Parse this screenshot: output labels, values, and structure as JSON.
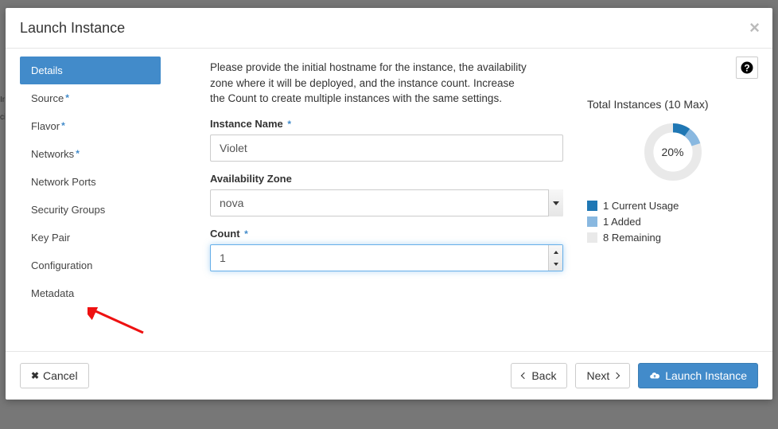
{
  "modal": {
    "title": "Launch Instance"
  },
  "sidebar": {
    "items": [
      {
        "label": "Details",
        "active": true,
        "required": false
      },
      {
        "label": "Source",
        "active": false,
        "required": true
      },
      {
        "label": "Flavor",
        "active": false,
        "required": true
      },
      {
        "label": "Networks",
        "active": false,
        "required": true
      },
      {
        "label": "Network Ports",
        "active": false,
        "required": false
      },
      {
        "label": "Security Groups",
        "active": false,
        "required": false
      },
      {
        "label": "Key Pair",
        "active": false,
        "required": false
      },
      {
        "label": "Configuration",
        "active": false,
        "required": false
      },
      {
        "label": "Metadata",
        "active": false,
        "required": false
      }
    ]
  },
  "intro": "Please provide the initial hostname for the instance, the availability zone where it will be deployed, and the instance count. Increase the Count to create multiple instances with the same settings.",
  "form": {
    "instance_name": {
      "label": "Instance Name",
      "value": "Violet"
    },
    "availability_zone": {
      "label": "Availability Zone",
      "value": "nova"
    },
    "count": {
      "label": "Count",
      "value": "1"
    }
  },
  "quota": {
    "title": "Total Instances (10 Max)",
    "percent_label": "20%",
    "percent": 20,
    "current_percent": 10,
    "added_percent": 10,
    "legend": {
      "current": "1 Current Usage",
      "added": "1 Added",
      "remaining": "8 Remaining"
    },
    "colors": {
      "current": "#1f77b4",
      "added": "#89b8e0",
      "remaining": "#e9e9e9"
    }
  },
  "footer": {
    "cancel": "Cancel",
    "back": "Back",
    "next": "Next",
    "launch": "Launch Instance"
  },
  "chart_data": {
    "type": "pie",
    "title": "Total Instances (10 Max)",
    "series": [
      {
        "name": "Current Usage",
        "value": 1,
        "color": "#1f77b4"
      },
      {
        "name": "Added",
        "value": 1,
        "color": "#89b8e0"
      },
      {
        "name": "Remaining",
        "value": 8,
        "color": "#e9e9e9"
      }
    ],
    "center_label": "20%"
  }
}
